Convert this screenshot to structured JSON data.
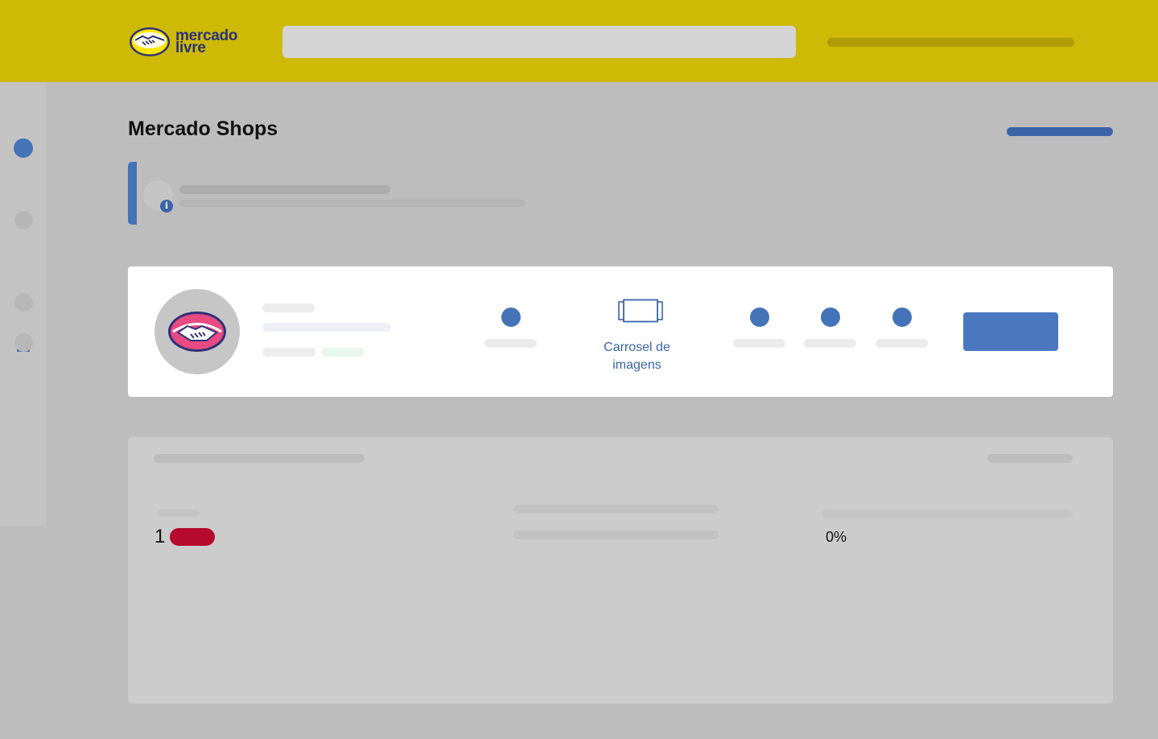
{
  "header": {
    "logo_line1": "mercado",
    "logo_line2": "livre",
    "logo_icon": "handshake-icon"
  },
  "sidebar": {
    "items": [
      {
        "icon": "circle-icon",
        "active": true
      },
      {
        "icon": "circle-icon",
        "active": false
      },
      {
        "icon": "store-icon",
        "active": false
      },
      {
        "icon": "circle-icon",
        "active": false
      },
      {
        "icon": "circle-icon",
        "active": false
      }
    ]
  },
  "page": {
    "title": "Mercado Shops"
  },
  "notice": {
    "icon": "info-icon",
    "info_glyph": "i"
  },
  "shop_card": {
    "avatar_icon": "handshake-icon",
    "features": [
      {
        "icon": "circle-icon"
      },
      {
        "icon": "carousel-icon",
        "label": "Carrosel de imagens"
      },
      {
        "icon": "circle-icon"
      },
      {
        "icon": "circle-icon"
      },
      {
        "icon": "circle-icon"
      }
    ]
  },
  "metrics": {
    "count": "1",
    "percent": "0%"
  },
  "colors": {
    "header_bg": "#cdb906",
    "accent_blue": "#4473b8",
    "badge_red": "#b50a2c",
    "page_bg": "#bebdbe"
  }
}
